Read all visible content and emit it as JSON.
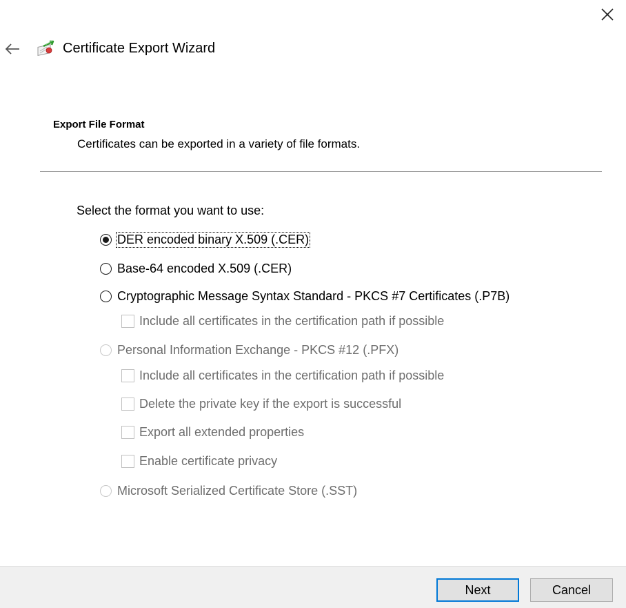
{
  "window": {
    "title": "Certificate Export Wizard",
    "close_icon": "close-icon",
    "back_icon": "back-arrow-icon",
    "wizard_icon": "certificate-icon"
  },
  "header": {
    "section_title": "Export File Format",
    "section_description": "Certificates can be exported in a variety of file formats."
  },
  "form": {
    "prompt": "Select the format you want to use:",
    "options": {
      "der": {
        "label": "DER encoded binary X.509 (.CER)",
        "selected": true,
        "enabled": true
      },
      "base64": {
        "label": "Base-64 encoded X.509 (.CER)",
        "selected": false,
        "enabled": true
      },
      "pkcs7": {
        "label": "Cryptographic Message Syntax Standard - PKCS #7 Certificates (.P7B)",
        "selected": false,
        "enabled": true
      },
      "pkcs7_include_all": {
        "label": "Include all certificates in the certification path if possible",
        "checked": false,
        "enabled": false
      },
      "pfx": {
        "label": "Personal Information Exchange - PKCS #12 (.PFX)",
        "selected": false,
        "enabled": false
      },
      "pfx_include_all": {
        "label": "Include all certificates in the certification path if possible",
        "checked": false,
        "enabled": false
      },
      "pfx_delete_key": {
        "label": "Delete the private key if the export is successful",
        "checked": false,
        "enabled": false
      },
      "pfx_export_extended": {
        "label": "Export all extended properties",
        "checked": false,
        "enabled": false
      },
      "pfx_enable_privacy": {
        "label": "Enable certificate privacy",
        "checked": false,
        "enabled": false
      },
      "sst": {
        "label": "Microsoft Serialized Certificate Store (.SST)",
        "selected": false,
        "enabled": false
      }
    }
  },
  "footer": {
    "next_label": "Next",
    "cancel_label": "Cancel"
  },
  "colors": {
    "accent": "#0078d7",
    "disabled_text": "#6d6d6d",
    "footer_bg": "#f0f0f0"
  }
}
